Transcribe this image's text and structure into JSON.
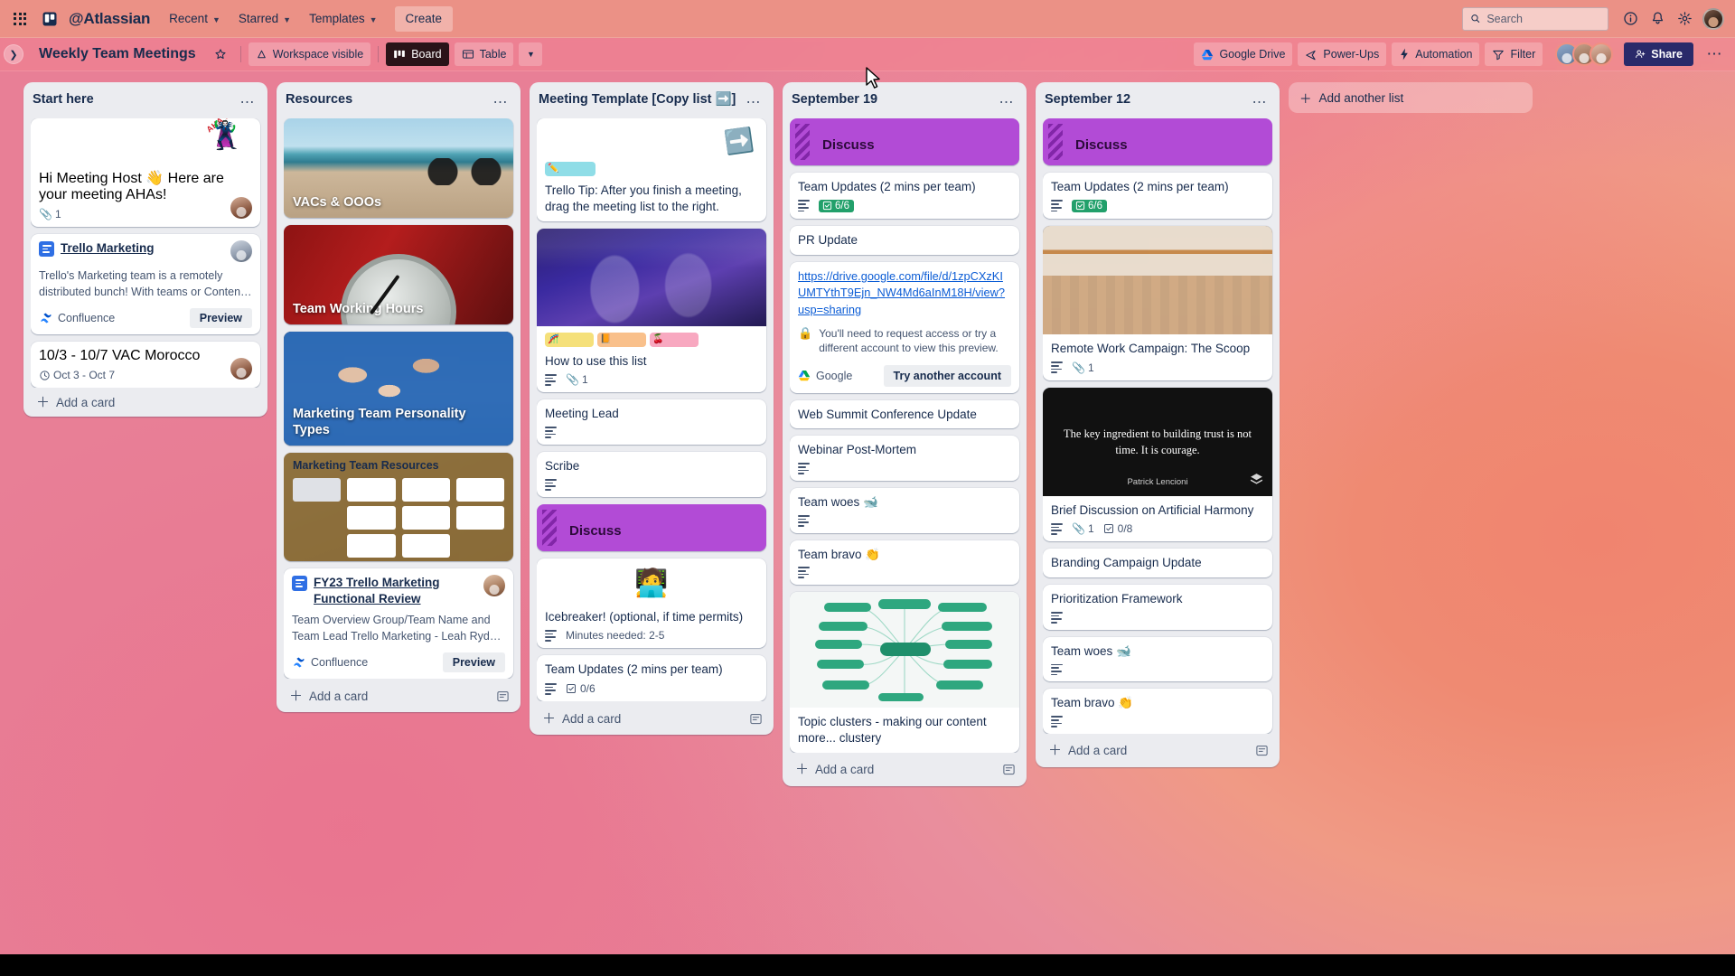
{
  "topnav": {
    "apps_icon": "apps-grid-icon",
    "logo_icon": "trello-logo-icon",
    "brand": "@Atlassian",
    "menus": [
      {
        "label": "Recent",
        "icon": "chevron-down-icon"
      },
      {
        "label": "Starred",
        "icon": "chevron-down-icon"
      },
      {
        "label": "Templates",
        "icon": "chevron-down-icon"
      }
    ],
    "create_label": "Create",
    "search": {
      "placeholder": "Search",
      "value": "",
      "icon": "search-icon"
    },
    "info_icon": "info-circle-icon",
    "notifications_icon": "bell-icon",
    "settings_icon": "gear-icon",
    "avatar": "user-avatar"
  },
  "boardbar": {
    "sidebar_toggle_icon": "chevron-right-icon",
    "title": "Weekly Team Meetings",
    "star_icon": "star-icon",
    "visibility": {
      "label": "Workspace visible",
      "icon": "workspace-icon"
    },
    "views": [
      {
        "label": "Board",
        "icon": "board-icon",
        "active": true
      },
      {
        "label": "Table",
        "icon": "table-icon",
        "active": false
      }
    ],
    "view_caret_icon": "chevron-down-icon",
    "right_buttons": [
      {
        "label": "Google Drive",
        "icon": "google-drive-icon"
      },
      {
        "label": "Power-Ups",
        "icon": "power-ups-icon"
      },
      {
        "label": "Automation",
        "icon": "automation-bolt-icon"
      },
      {
        "label": "Filter",
        "icon": "filter-icon"
      }
    ],
    "share_label": "Share",
    "share_icon": "person-add-icon",
    "more_icon": "ellipsis-horizontal-icon",
    "members": [
      "member-avatar-1",
      "member-avatar-2",
      "member-avatar-3"
    ]
  },
  "add_list": {
    "label": "Add another list",
    "icon": "plus-icon"
  },
  "list_footer": {
    "add_card": "Add a card",
    "template_icon": "card-template-icon",
    "plus_icon": "plus-icon"
  },
  "colors": {
    "discuss_label": "#b24bd6",
    "checklist_complete": "#4bce97",
    "link_blue": "#0b5cd5",
    "share_button": "#2a2a6a"
  },
  "lists": [
    {
      "id": "start-here",
      "title": "Start here",
      "menu_icon": "list-menu-icon",
      "cards": [
        {
          "type": "aha",
          "title": "Hi Meeting Host 👋 Here are your meeting AHAs!",
          "aha_text": "AHA !!!",
          "emoji": "🦹",
          "attachments": "1",
          "avatar": "av-a"
        },
        {
          "type": "confluence-link",
          "title": "Trello Marketing",
          "description": "Trello's Marketing team is a remotely distributed bunch! With teams or Conten…",
          "source": "Confluence",
          "preview_label": "Preview",
          "avatar": "av-b"
        },
        {
          "type": "plain",
          "title": "10/3 - 10/7 VAC Morocco",
          "due": "Oct 3 - Oct 7",
          "due_icon": "clock-icon",
          "avatar": "av-a"
        }
      ]
    },
    {
      "id": "resources",
      "title": "Resources",
      "menu_icon": "list-menu-icon",
      "cards": [
        {
          "type": "cover",
          "cover": "beach",
          "title": "VACs & OOOs"
        },
        {
          "type": "cover",
          "cover": "clock",
          "title": "Team Working Hours"
        },
        {
          "type": "cover",
          "cover": "lego",
          "title": "Marketing Team Personality Types"
        },
        {
          "type": "board-preview",
          "title": "Marketing Team Resources"
        },
        {
          "type": "confluence-link",
          "title": "FY23 Trello Marketing Functional Review",
          "description": "Team Overview Group/Team Name and Team Lead Trello Marketing - Leah Ryd…",
          "source": "Confluence",
          "preview_label": "Preview",
          "avatar": "av-c"
        }
      ]
    },
    {
      "id": "meeting-template",
      "title": "Meeting Template [Copy list ➡️]",
      "menu_icon": "list-menu-icon",
      "cards": [
        {
          "type": "tip",
          "arrow": "➡️",
          "labels": [
            {
              "color": "teal",
              "glyph": "✏️"
            }
          ],
          "title": "Trello Tip: After you finish a meeting, drag the meeting list to the right."
        },
        {
          "type": "cover-labels",
          "cover": "meeting",
          "labels": [
            {
              "color": "yellow",
              "glyph": "🎢"
            },
            {
              "color": "orange",
              "glyph": "📙"
            },
            {
              "color": "pink",
              "glyph": "🍒"
            }
          ],
          "title": "How to use this list",
          "has_description": true,
          "attachments": "1"
        },
        {
          "type": "plain-desc",
          "title": "Meeting Lead",
          "has_description": true
        },
        {
          "type": "plain-desc",
          "title": "Scribe",
          "has_description": true
        },
        {
          "type": "discuss",
          "title": "Discuss"
        },
        {
          "type": "icebreaker",
          "emoji": "🧑‍💻",
          "title": "Icebreaker! (optional, if time permits)",
          "meta": "Minutes needed: 2-5",
          "has_description": true
        },
        {
          "type": "checklist",
          "title": "Team Updates (2 mins per team)",
          "checklist": "0/6",
          "has_description": true
        }
      ]
    },
    {
      "id": "september-19",
      "title": "September 19",
      "menu_icon": "list-menu-icon",
      "cards": [
        {
          "type": "discuss",
          "title": "Discuss"
        },
        {
          "type": "checklist",
          "title": "Team Updates (2 mins per team)",
          "checklist": "6/6",
          "checklist_done": true,
          "has_description": true
        },
        {
          "type": "plain",
          "title": "PR Update"
        },
        {
          "type": "gdrive",
          "url": "https://drive.google.com/file/d/1zpCXzKIUMTYthT9Ejn_NW4Md6aInM18H/view?usp=sharing",
          "warning": "You'll need to request access or try a different account to view this preview.",
          "warning_icon": "lock-icon",
          "source": "Google",
          "button": "Try another account"
        },
        {
          "type": "plain",
          "title": "Web Summit Conference Update"
        },
        {
          "type": "plain-desc",
          "title": "Webinar Post-Mortem",
          "has_description": true
        },
        {
          "type": "plain-desc",
          "title": "Team woes 🐋",
          "has_description": true
        },
        {
          "type": "plain-desc",
          "title": "Team bravo 👏",
          "has_description": true
        },
        {
          "type": "mindmap",
          "title": "Topic clusters - making our content more... clustery"
        }
      ]
    },
    {
      "id": "september-12",
      "title": "September 12",
      "menu_icon": "list-menu-icon",
      "cards": [
        {
          "type": "discuss",
          "title": "Discuss"
        },
        {
          "type": "checklist",
          "title": "Team Updates (2 mins per team)",
          "checklist": "6/6",
          "checklist_done": true,
          "has_description": true
        },
        {
          "type": "cover-card",
          "cover": "icecream",
          "title": "Remote Work Campaign: The Scoop",
          "has_description": true,
          "attachments": "1"
        },
        {
          "type": "quote-card",
          "quote": "The key ingredient to building trust is not time. It is courage.",
          "author": "Patrick Lencioni",
          "title": "Brief Discussion on Artificial Harmony",
          "has_description": true,
          "attachments": "1",
          "checklist": "0/8"
        },
        {
          "type": "plain",
          "title": "Branding Campaign Update"
        },
        {
          "type": "plain-desc",
          "title": "Prioritization Framework",
          "has_description": true
        },
        {
          "type": "plain-desc",
          "title": "Team woes 🐋",
          "has_description": true
        },
        {
          "type": "plain-desc",
          "title": "Team bravo 👏",
          "has_description": true
        }
      ]
    }
  ]
}
